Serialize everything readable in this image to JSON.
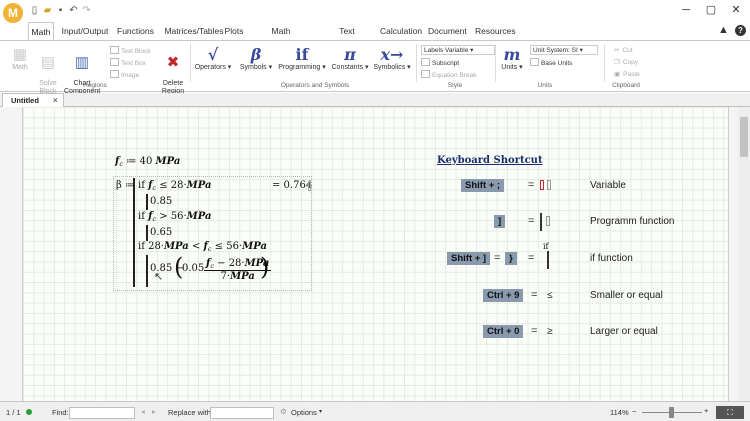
{
  "window": {
    "app_logo_letter": "M",
    "minimize": "─",
    "maximize": "▢",
    "close": "✕",
    "help_icon_glyph": "?"
  },
  "ribbon_tabs": [
    "Math",
    "Input/Output",
    "Functions",
    "Matrices/Tables",
    "Plots",
    "Math Formatting",
    "Text Formatting",
    "Calculation",
    "Document",
    "Resources"
  ],
  "regions_group": {
    "label": "Regions",
    "math": "Math",
    "solve_block": "Solve\nBlock",
    "chart_component": "Chart\nComponent",
    "text_block": "Text Block",
    "text_box": "Text Box",
    "image": "Image",
    "delete_region": "Delete\nRegion"
  },
  "operators_group": {
    "label": "Operators and Symbols",
    "operators": "Operators",
    "symbols": "Symbols",
    "programming": "Programming",
    "constants": "Constants",
    "symbolics": "Symbolics",
    "operators_glyph": "√",
    "symbols_glyph": "β",
    "programming_glyph": "if",
    "constants_glyph": "π",
    "symbolics_glyph": "x→"
  },
  "style_group": {
    "label": "Style",
    "labels_text": "Labels",
    "labels_value": "Variable",
    "subscript": "Subscript",
    "equation_break": "Equation Break"
  },
  "units_group": {
    "label": "Units",
    "units": "Units",
    "units_glyph": "m",
    "unit_system_text": "Unit System:",
    "unit_system_value": "SI",
    "base_units": "Base Units"
  },
  "clipboard_group": {
    "label": "Clipboard",
    "cut": "Cut",
    "copy": "Copy",
    "paste": "Paste"
  },
  "doc_tab": {
    "title": "Untitled",
    "close": "×"
  },
  "worksheet": {
    "fc_def": {
      "f": "f",
      "sub": "c",
      "assign": " ≔ 40 ",
      "unit": "MPa"
    },
    "beta": {
      "label": "β ≔",
      "result": "= 0.764",
      "line1": {
        "kw": "if ",
        "f": "f",
        "sub": "c",
        "rest": " ≤ 28·",
        "unit": "MPa"
      },
      "val1": "0.85",
      "line2": {
        "kw": "if ",
        "f": "f",
        "sub": "c",
        "rest": " > 56·",
        "unit": "MPa"
      },
      "val2": "0.65",
      "line3": {
        "kw": "if ",
        "a": "28·",
        "u1": "MPa",
        "b": " < ",
        "f": "f",
        "sub": "c",
        "c": " ≤ 56·",
        "u2": "MPa"
      },
      "line4": {
        "lead": "0.85 − ",
        "lp": "(",
        "k": "0.05·",
        "rp": ")",
        "num_f": "f",
        "num_sub": "c",
        "num_rest": " − 28·",
        "num_unit": "MPa",
        "den": "7·",
        "den_unit": "MPa"
      }
    },
    "shortcuts": {
      "title": "Keyboard Shortcut",
      "rows": [
        {
          "key": "Shift + ;",
          "eq": "=",
          "desc": "Variable"
        },
        {
          "key": "]",
          "eq": "=",
          "desc": "Programm function"
        },
        {
          "key": "Shift + ]",
          "key2": "}",
          "eq": "=",
          "ifword": "if",
          "desc": "if function"
        },
        {
          "key": "Ctrl + 9",
          "eq": "=",
          "sym": "≤",
          "desc": "Smaller or equal"
        },
        {
          "key": "Ctrl + 0",
          "eq": "=",
          "sym": "≥",
          "desc": "Larger or equal"
        }
      ]
    }
  },
  "status": {
    "page": "1 / 1",
    "find_label": "Find:",
    "replace_label": "Replace with:",
    "options": "Options",
    "zoom": "114%"
  }
}
